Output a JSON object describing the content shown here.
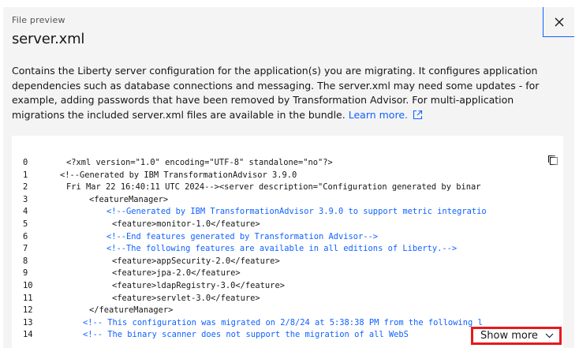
{
  "modal": {
    "eyebrow": "File preview",
    "title": "server.xml",
    "description_lines": [
      "Contains the Liberty server configuration for the application(s) you are migrating. It configures application",
      "dependencies such as database connections and messaging. The server.xml may need some updates - for",
      "example, adding passwords that have been removed by Transformation Advisor. For multi-application",
      "migrations the included server.xml files are available in the bundle."
    ],
    "learn_more": "Learn more.",
    "close_icon": "close-icon",
    "copy_icon": "copy-icon",
    "external_link_icon": "launch-icon",
    "accent_color": "#0f62fe"
  },
  "code": {
    "lines": [
      {
        "n": "0",
        "text": "<?xml version=\"1.0\" encoding=\"UTF-8\" standalone=\"no\"?>",
        "comment": false
      },
      {
        "n": "1",
        "text": "<!--Generated by IBM TransformationAdvisor 3.9.0",
        "comment": false
      },
      {
        "n": "2",
        "text": "Fri Mar 22 16:40:11 UTC 2024--><server description=\"Configuration generated by binar",
        "comment": false
      },
      {
        "n": "3",
        "text": "<featureManager>",
        "comment": false
      },
      {
        "n": "4",
        "text": "<!--Generated by IBM TransformationAdvisor 3.9.0 to support metric integratio",
        "comment": true
      },
      {
        "n": "5",
        "text": "<feature>monitor-1.0</feature>",
        "comment": false
      },
      {
        "n": "6",
        "text": "<!--End features generated by Transformation Advisor-->",
        "comment": true
      },
      {
        "n": "7",
        "text": "<!--The following features are available in all editions of Liberty.-->",
        "comment": true
      },
      {
        "n": "8",
        "text": "<feature>appSecurity-2.0</feature>",
        "comment": false
      },
      {
        "n": "9",
        "text": "<feature>jpa-2.0</feature>",
        "comment": false
      },
      {
        "n": "10",
        "text": "<feature>ldapRegistry-3.0</feature>",
        "comment": false
      },
      {
        "n": "11",
        "text": "<feature>servlet-3.0</feature>",
        "comment": false
      },
      {
        "n": "12",
        "text": "</featureManager>",
        "comment": false
      },
      {
        "n": "13",
        "text": "<!-- This configuration was migrated on 2/8/24 at 5:38:38 PM from the following l",
        "comment": true
      },
      {
        "n": "14",
        "text": "<!-- The binary scanner does not support the migration of all WebS",
        "comment": true
      }
    ]
  },
  "show_more": {
    "label": "Show more",
    "icon": "chevron-down-icon"
  }
}
